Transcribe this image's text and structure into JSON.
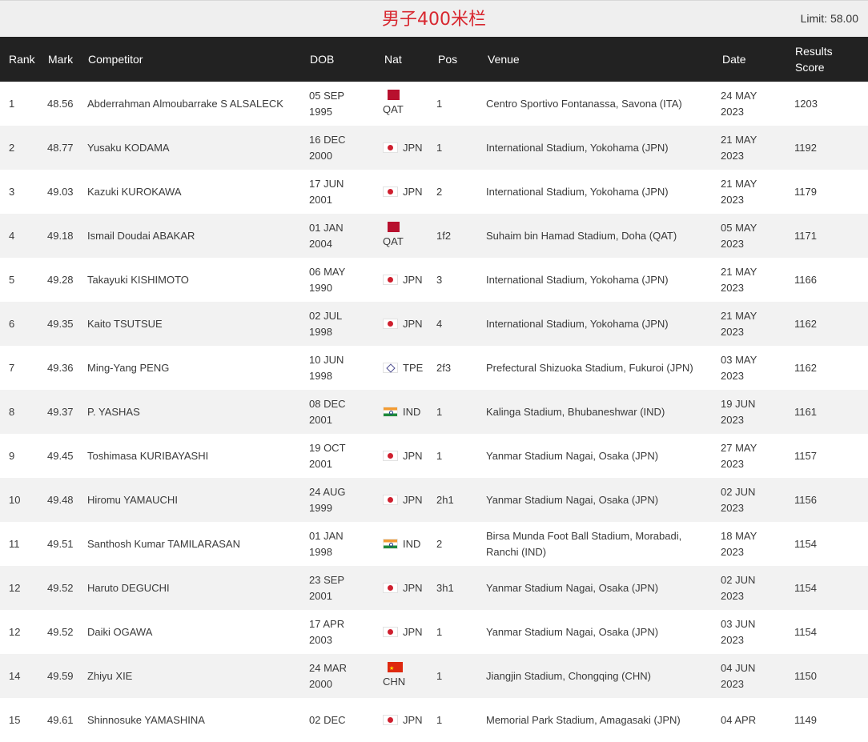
{
  "header": {
    "title": "男子400米栏",
    "limit": "Limit: 58.00"
  },
  "columns": {
    "rank": "Rank",
    "mark": "Mark",
    "competitor": "Competitor",
    "dob": "DOB",
    "nat": "Nat",
    "pos": "Pos",
    "venue": "Venue",
    "date": "Date",
    "score_line1": "Results",
    "score_line2": "Score"
  },
  "rows": [
    {
      "rank": "1",
      "mark": "48.56",
      "competitor": "Abderrahman Almoubarrake S ALSALECK",
      "dob1": "05 SEP",
      "dob2": "1995",
      "nat": "QAT",
      "flag": "flag-qat-icon",
      "pos": "1",
      "venue": "Centro Sportivo Fontanassa, Savona (ITA)",
      "date1": "24 MAY",
      "date2": "2023",
      "score": "1203"
    },
    {
      "rank": "2",
      "mark": "48.77",
      "competitor": "Yusaku KODAMA",
      "dob1": "16 DEC",
      "dob2": "2000",
      "nat": "JPN",
      "flag": "flag-jpn-icon",
      "pos": "1",
      "venue": "International Stadium, Yokohama (JPN)",
      "date1": "21 MAY",
      "date2": "2023",
      "score": "1192"
    },
    {
      "rank": "3",
      "mark": "49.03",
      "competitor": "Kazuki KUROKAWA",
      "dob1": "17 JUN",
      "dob2": "2001",
      "nat": "JPN",
      "flag": "flag-jpn-icon",
      "pos": "2",
      "venue": "International Stadium, Yokohama (JPN)",
      "date1": "21 MAY",
      "date2": "2023",
      "score": "1179"
    },
    {
      "rank": "4",
      "mark": "49.18",
      "competitor": "Ismail Doudai ABAKAR",
      "dob1": "01 JAN",
      "dob2": "2004",
      "nat": "QAT",
      "flag": "flag-qat-icon",
      "pos": "1f2",
      "venue": "Suhaim bin Hamad Stadium, Doha (QAT)",
      "date1": "05 MAY",
      "date2": "2023",
      "score": "1171"
    },
    {
      "rank": "5",
      "mark": "49.28",
      "competitor": "Takayuki KISHIMOTO",
      "dob1": "06 MAY",
      "dob2": "1990",
      "nat": "JPN",
      "flag": "flag-jpn-icon",
      "pos": "3",
      "venue": "International Stadium, Yokohama (JPN)",
      "date1": "21 MAY",
      "date2": "2023",
      "score": "1166"
    },
    {
      "rank": "6",
      "mark": "49.35",
      "competitor": "Kaito TSUTSUE",
      "dob1": "02 JUL",
      "dob2": "1998",
      "nat": "JPN",
      "flag": "flag-jpn-icon",
      "pos": "4",
      "venue": "International Stadium, Yokohama (JPN)",
      "date1": "21 MAY",
      "date2": "2023",
      "score": "1162"
    },
    {
      "rank": "7",
      "mark": "49.36",
      "competitor": "Ming-Yang PENG",
      "dob1": "10 JUN",
      "dob2": "1998",
      "nat": "TPE",
      "flag": "flag-tpe-icon",
      "pos": "2f3",
      "venue": "Prefectural Shizuoka Stadium, Fukuroi (JPN)",
      "date1": "03 MAY",
      "date2": "2023",
      "score": "1162"
    },
    {
      "rank": "8",
      "mark": "49.37",
      "competitor": "P. YASHAS",
      "dob1": "08 DEC",
      "dob2": "2001",
      "nat": "IND",
      "flag": "flag-ind-icon",
      "pos": "1",
      "venue": "Kalinga Stadium, Bhubaneshwar (IND)",
      "date1": "19 JUN",
      "date2": "2023",
      "score": "1161"
    },
    {
      "rank": "9",
      "mark": "49.45",
      "competitor": "Toshimasa KURIBAYASHI",
      "dob1": "19 OCT",
      "dob2": "2001",
      "nat": "JPN",
      "flag": "flag-jpn-icon",
      "pos": "1",
      "venue": "Yanmar Stadium Nagai, Osaka (JPN)",
      "date1": "27 MAY",
      "date2": "2023",
      "score": "1157"
    },
    {
      "rank": "10",
      "mark": "49.48",
      "competitor": "Hiromu YAMAUCHI",
      "dob1": "24 AUG",
      "dob2": "1999",
      "nat": "JPN",
      "flag": "flag-jpn-icon",
      "pos": "2h1",
      "venue": "Yanmar Stadium Nagai, Osaka (JPN)",
      "date1": "02 JUN",
      "date2": "2023",
      "score": "1156"
    },
    {
      "rank": "11",
      "mark": "49.51",
      "competitor": "Santhosh Kumar TAMILARASAN",
      "dob1": "01 JAN",
      "dob2": "1998",
      "nat": "IND",
      "flag": "flag-ind-icon",
      "pos": "2",
      "venue": "Birsa Munda Foot Ball Stadium, Morabadi, Ranchi (IND)",
      "date1": "18 MAY",
      "date2": "2023",
      "score": "1154"
    },
    {
      "rank": "12",
      "mark": "49.52",
      "competitor": "Haruto DEGUCHI",
      "dob1": "23 SEP",
      "dob2": "2001",
      "nat": "JPN",
      "flag": "flag-jpn-icon",
      "pos": "3h1",
      "venue": "Yanmar Stadium Nagai, Osaka (JPN)",
      "date1": "02 JUN",
      "date2": "2023",
      "score": "1154"
    },
    {
      "rank": "12",
      "mark": "49.52",
      "competitor": "Daiki OGAWA",
      "dob1": "17 APR",
      "dob2": "2003",
      "nat": "JPN",
      "flag": "flag-jpn-icon",
      "pos": "1",
      "venue": "Yanmar Stadium Nagai, Osaka (JPN)",
      "date1": "03 JUN",
      "date2": "2023",
      "score": "1154"
    },
    {
      "rank": "14",
      "mark": "49.59",
      "competitor": "Zhiyu XIE",
      "dob1": "24 MAR",
      "dob2": "2000",
      "nat": "CHN",
      "flag": "flag-chn-icon",
      "pos": "1",
      "venue": "Jiangjin Stadium, Chongqing (CHN)",
      "date1": "04 JUN",
      "date2": "2023",
      "score": "1150"
    },
    {
      "rank": "15",
      "mark": "49.61",
      "competitor": "Shinnosuke YAMASHINA",
      "dob1": "02 DEC",
      "dob2": "",
      "nat": "JPN",
      "flag": "flag-jpn-icon",
      "pos": "1",
      "venue": "Memorial Park Stadium, Amagasaki (JPN)",
      "date1": "04 APR",
      "date2": "",
      "score": "1149"
    }
  ]
}
